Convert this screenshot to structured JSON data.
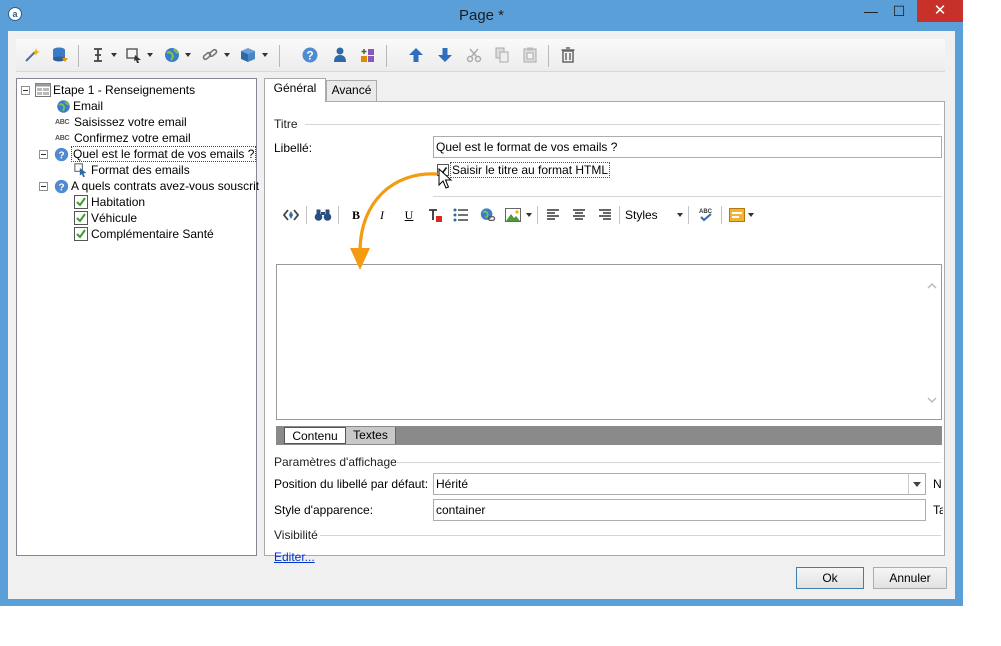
{
  "window": {
    "title": "Page *",
    "close_glyph": "✕",
    "minimize_glyph": "—",
    "maximize_glyph": "☐"
  },
  "toolbar": {
    "icons": [
      "wand-icon",
      "database-icon",
      "text-cursor-icon",
      "form-element-icon",
      "globe-icon",
      "link-icon",
      "cube-icon",
      "help-icon",
      "person-icon",
      "add-shapes-icon",
      "move-up-icon",
      "move-down-icon",
      "cut-icon",
      "copy-icon",
      "paste-icon",
      "delete-icon"
    ]
  },
  "tree": {
    "items": [
      {
        "label": "Etape 1 - Renseignements",
        "icon": "page-icon",
        "level": 0,
        "expanded": true
      },
      {
        "label": "Email",
        "icon": "globe-icon",
        "level": 1
      },
      {
        "label": "Saisissez votre email",
        "icon": "abc-icon",
        "level": 1
      },
      {
        "label": "Confirmez votre email",
        "icon": "abc-icon",
        "level": 1
      },
      {
        "label": "Quel est le format de vos emails ?",
        "icon": "question-icon",
        "level": 1,
        "expanded": true,
        "selected": true
      },
      {
        "label": "Format des emails",
        "icon": "cursor-field-icon",
        "level": 2
      },
      {
        "label": "A quels contrats avez-vous souscrit",
        "icon": "question-icon",
        "level": 1,
        "expanded": true
      },
      {
        "label": "Habitation",
        "icon": "checkbox-icon",
        "level": 2
      },
      {
        "label": "Véhicule",
        "icon": "checkbox-icon",
        "level": 2
      },
      {
        "label": "Complémentaire Santé",
        "icon": "checkbox-icon",
        "level": 2
      }
    ],
    "abc_text": "ABC"
  },
  "tabs": [
    {
      "label": "Général",
      "active": true
    },
    {
      "label": "Avancé",
      "active": false
    }
  ],
  "general": {
    "section_title": "Titre",
    "libelle_label": "Libellé:",
    "libelle_value": "Quel est le format de vos emails ?",
    "html_checkbox_label": "Saisir le titre au format HTML",
    "html_checkbox_checked": true,
    "editor_toolbar": {
      "bold": "B",
      "italic": "I",
      "underline": "U",
      "styles_label": "Styles"
    },
    "editor_tabs": [
      "Contenu",
      "Textes"
    ],
    "display_section": "Paramètres d'affichage",
    "position_label": "Position du libellé par défaut:",
    "position_value": "Hérité",
    "position_right_cut": "N",
    "style_label": "Style d'apparence:",
    "style_value": "container",
    "style_right_cut": "Ta",
    "visibility_section": "Visibilité",
    "edit_link": "Editer..."
  },
  "buttons": {
    "ok": "Ok",
    "cancel": "Annuler"
  },
  "colors": {
    "window_frame": "#5b9fd9",
    "close_button": "#c7312a",
    "annotation_arrow": "#f39c12",
    "link": "#0033cc"
  }
}
